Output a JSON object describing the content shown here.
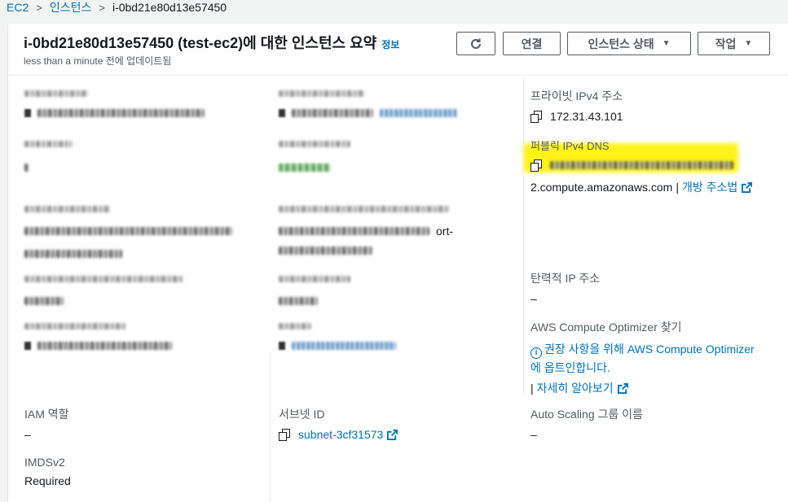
{
  "breadcrumb": {
    "items": [
      "EC2",
      "인스턴스",
      "i-0bd21e80d13e57450"
    ]
  },
  "header": {
    "title": "i-0bd21e80d13e57450 (test-ec2)에 대한 인스턴스 요약",
    "info_label": "정보",
    "updated": "less than a minute 전에 업데이트됨",
    "refresh_icon": "refresh-icon",
    "connect_label": "연결",
    "instance_state_label": "인스턴스 상태",
    "actions_label": "작업"
  },
  "right_col": {
    "private_ipv4_label": "프라이빗 IPv4 주소",
    "private_ipv4_value": "172.31.43.101",
    "public_dns_label": "퍼블릭 IPv4 DNS",
    "public_dns_suffix": "2.compute.amazonaws.com",
    "public_dns_sep": "|",
    "public_dns_open": "개방 주소법",
    "elastic_ip_label": "탄력적 IP 주소",
    "elastic_ip_value": "–",
    "optimizer_label": "AWS Compute Optimizer 찾기",
    "optimizer_line1": "권장 사항을 위해 AWS Compute Optimizer",
    "optimizer_line2": "에 옵트인합니다.",
    "learn_more_sep": "|",
    "learn_more": "자세히 알아보기",
    "asg_label": "Auto Scaling 그룹 이름",
    "asg_value": "–",
    "highlight_color": "#fff200"
  },
  "mid_col": {
    "subnet_label": "서브넷 ID",
    "subnet_value": "subnet-3cf31573",
    "partial_text_1": "ort-",
    "partial_text_2": "-t"
  },
  "left_col": {
    "iam_label": "IAM 역할",
    "iam_value": "–",
    "imds_label": "IMDSv2",
    "imds_value": "Required"
  },
  "colors": {
    "link": "#0073bb",
    "text": "#16191f",
    "muted": "#545b64",
    "background": "#f2f3f3"
  }
}
